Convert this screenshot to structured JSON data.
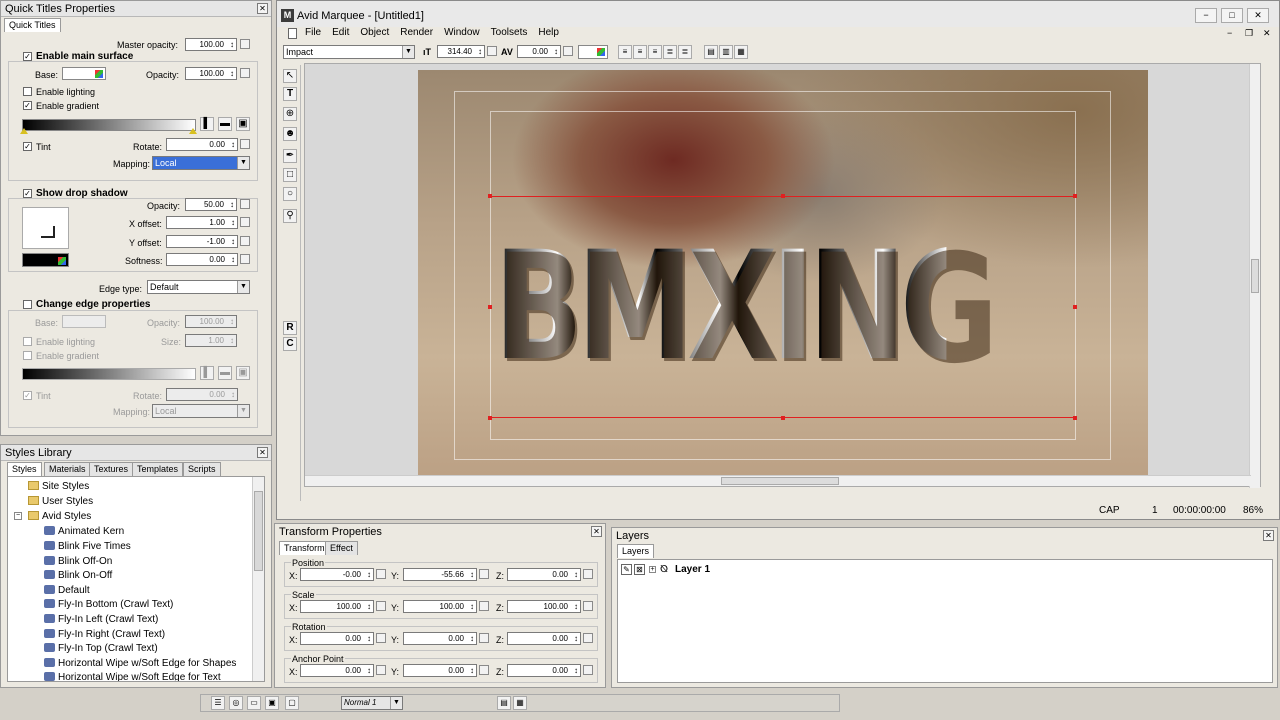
{
  "qt": {
    "title": "Quick Titles Properties",
    "tab": "Quick Titles",
    "master_opacity_label": "Master opacity:",
    "master_opacity": "100.00",
    "enable_main_surface": "Enable main surface",
    "base_label": "Base:",
    "opacity_label": "Opacity:",
    "main_opacity": "100.00",
    "enable_lighting": "Enable lighting",
    "enable_gradient": "Enable gradient",
    "tint": "Tint",
    "rotate_label": "Rotate:",
    "rotate": "0.00",
    "mapping_label": "Mapping:",
    "mapping": "Local",
    "show_drop_shadow": "Show drop shadow",
    "shadow_opacity": "50.00",
    "x_offset_label": "X offset:",
    "x_offset": "1.00",
    "y_offset_label": "Y offset:",
    "y_offset": "-1.00",
    "softness_label": "Softness:",
    "softness": "0.00",
    "edge_type_label": "Edge type:",
    "edge_type": "Default",
    "change_edge": "Change edge properties",
    "edge_opacity": "100.00",
    "size_label": "Size:",
    "edge_size": "1.00",
    "edge_rotate": "0.00",
    "edge_mapping": "Local"
  },
  "lib": {
    "title": "Styles Library",
    "tabs": [
      "Styles",
      "Materials",
      "Textures",
      "Templates",
      "Scripts"
    ],
    "items": [
      "Site Styles",
      "User Styles",
      "Avid Styles",
      "Animated Kern",
      "Blink Five Times",
      "Blink Off-On",
      "Blink On-Off",
      "Default",
      "Fly-In Bottom (Crawl Text)",
      "Fly-In Left (Crawl Text)",
      "Fly-In Right (Crawl Text)",
      "Fly-In Top (Crawl Text)",
      "Horizontal Wipe w/Soft Edge for Shapes",
      "Horizontal Wipe w/Soft Edge for Text"
    ]
  },
  "app": {
    "title": "Avid Marquee - [Untitled1]",
    "menu": [
      "File",
      "Edit",
      "Object",
      "Render",
      "Window",
      "Toolsets",
      "Help"
    ],
    "font": "Impact",
    "font_size": "314.40",
    "kerning": "0.00"
  },
  "canvas": {
    "title_text": "BMXING"
  },
  "status": {
    "cap": "CAP",
    "frame": "1",
    "timecode": "00:00:00:00",
    "zoom": "86%",
    "normal": "Normal 1"
  },
  "tp": {
    "title": "Transform Properties",
    "tabs": [
      "Transform",
      "Effect"
    ],
    "position": {
      "label": "Position",
      "x": "-0.00",
      "y": "-55.66",
      "z": "0.00"
    },
    "scale": {
      "label": "Scale",
      "x": "100.00",
      "y": "100.00",
      "z": "100.00"
    },
    "rotation": {
      "label": "Rotation",
      "x": "0.00",
      "y": "0.00",
      "z": "0.00"
    },
    "anchor": {
      "label": "Anchor Point",
      "x": "0.00",
      "y": "0.00",
      "z": "0.00"
    },
    "x_label": "X:",
    "y_label": "Y:",
    "z_label": "Z:"
  },
  "layers": {
    "title": "Layers",
    "tab": "Layers",
    "layer1": "Layer 1"
  }
}
